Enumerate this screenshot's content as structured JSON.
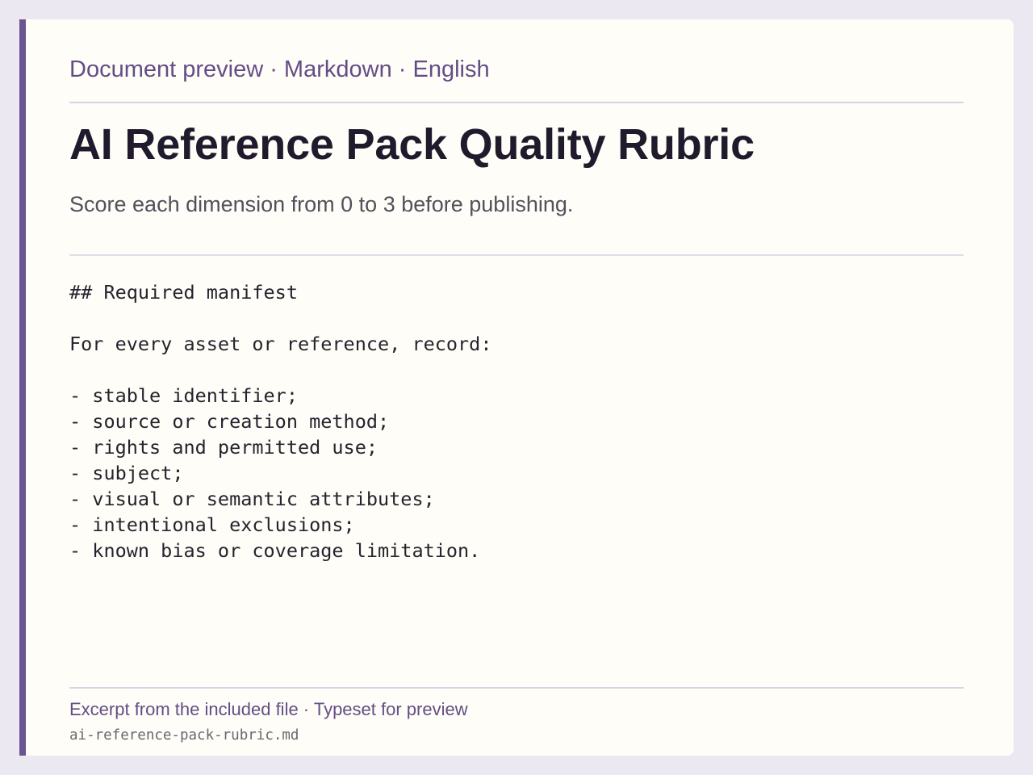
{
  "header": {
    "kicker": "Document preview · Markdown · English"
  },
  "document": {
    "title": "AI Reference Pack Quality Rubric",
    "subtitle": "Score each dimension from 0 to 3 before publishing.",
    "lines": [
      "## Required manifest",
      "",
      "For every asset or reference, record:",
      "",
      "- stable identifier;",
      "- source or creation method;",
      "- rights and permitted use;",
      "- subject;",
      "- visual or semantic attributes;",
      "- intentional exclusions;",
      "- known bias or coverage limitation."
    ]
  },
  "footer": {
    "note": "Excerpt from the included file · Typeset for preview",
    "filename": "ai-reference-pack-rubric.md"
  },
  "colors": {
    "accent": "#6a5591",
    "page_background": "#ebe8f2",
    "card_background": "#fefdf7",
    "title_text": "#201a2c"
  }
}
